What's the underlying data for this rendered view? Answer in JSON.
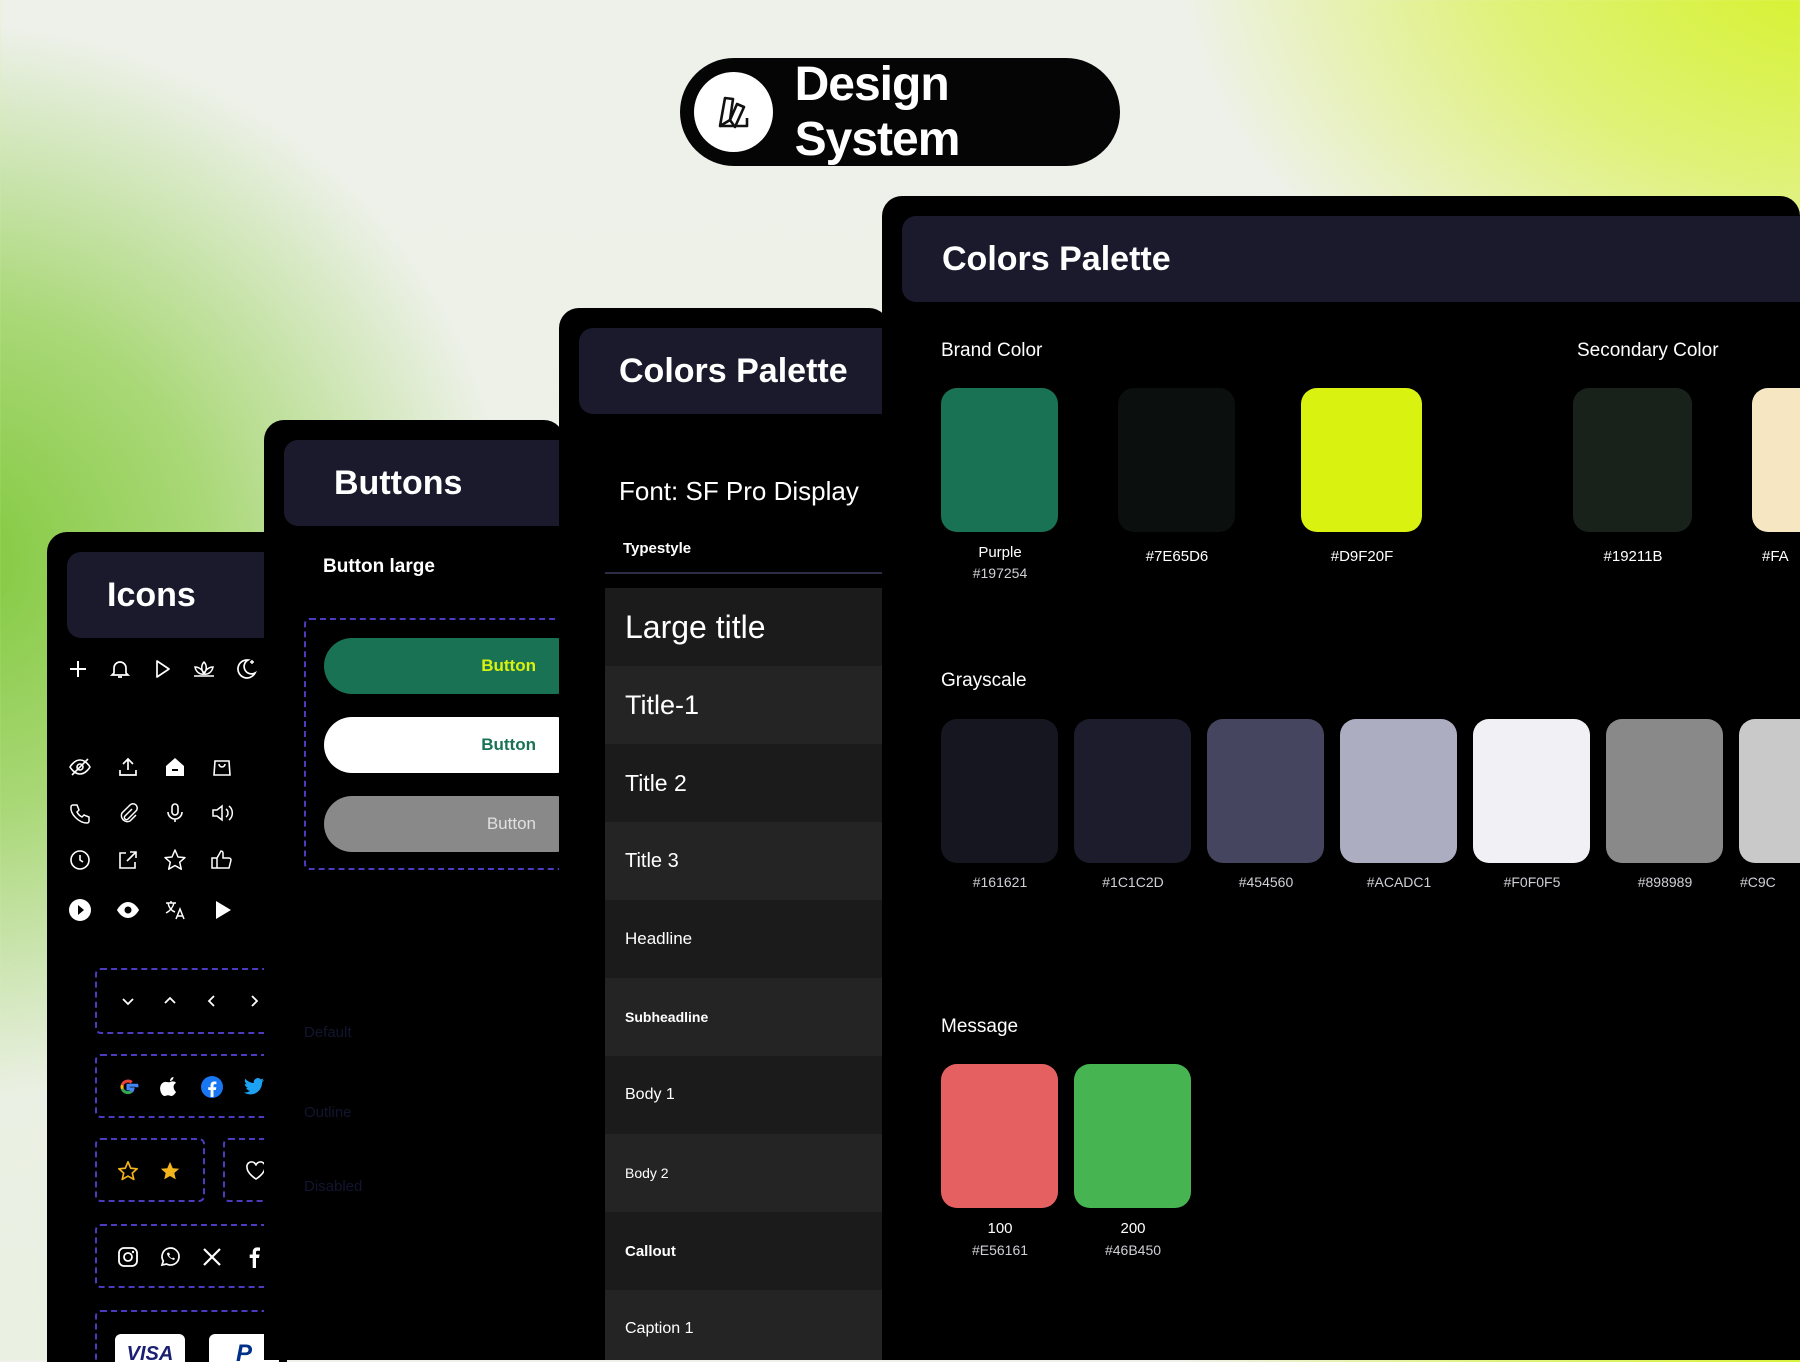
{
  "header": {
    "title": "Design System",
    "logo_icon": "color-swatch-icon"
  },
  "icons_card": {
    "title": "Icons",
    "icons_row1": [
      "plus-icon",
      "bell-icon",
      "play-outline-icon",
      "lotus-icon",
      "moon-star-icon"
    ],
    "icons_row2": [
      "eye-off-icon",
      "upload-icon",
      "home-filled-icon",
      "bag-icon"
    ],
    "icons_row3": [
      "phone-icon",
      "paperclip-icon",
      "microphone-icon",
      "speaker-icon"
    ],
    "icons_row4": [
      "clock-icon",
      "external-link-icon",
      "star-outline-icon",
      "thumbs-up-icon"
    ],
    "icons_row5": [
      "play-circle-icon",
      "eye-icon",
      "translate-icon",
      "play-filled-icon"
    ],
    "chevrons": [
      "chevron-down-icon",
      "chevron-up-icon",
      "chevron-left-icon",
      "chevron-right-icon"
    ],
    "brand_icons": [
      "google-icon",
      "apple-icon",
      "facebook-icon",
      "twitter-icon"
    ],
    "rating_icons": [
      "star-outline-icon",
      "star-filled-icon",
      "heart-icon"
    ],
    "social_icons": [
      "instagram-icon",
      "whatsapp-icon",
      "x-icon",
      "facebook-f-icon"
    ],
    "payment": {
      "visa": "VISA",
      "paypal": "P"
    }
  },
  "buttons_card": {
    "title": "Buttons",
    "subtitle": "Button large",
    "buttons": [
      {
        "label": "Button",
        "bg": "#197254",
        "color": "#D9F20F"
      },
      {
        "label": "Button",
        "bg": "#FFFFFF",
        "color": "#197254"
      },
      {
        "label": "Button",
        "bg": "#898989",
        "color": "#E0E0E0"
      }
    ],
    "faint_labels": [
      "Default",
      "Outline",
      "Disabled"
    ]
  },
  "type_card": {
    "title": "Colors Palette",
    "font_label": "Font: SF Pro Display",
    "typestyle_header": "Typestyle",
    "styles": [
      "Large title",
      "Title-1",
      "Title 2",
      "Title 3",
      "Headline",
      "Subheadline",
      "Body 1",
      "Body 2",
      "Callout",
      "Caption 1"
    ]
  },
  "colors_card": {
    "title": "Colors Palette",
    "brand_label": "Brand Color",
    "secondary_label": "Secondary Color",
    "grayscale_label": "Grayscale",
    "message_label": "Message",
    "brand": [
      {
        "name": "Purple",
        "hex": "#197254",
        "fill": "#197254"
      },
      {
        "name": "",
        "hex": "#7E65D6",
        "fill": "#0b0f0d"
      },
      {
        "name": "",
        "hex": "#D9F20F",
        "fill": "#D9F20F"
      }
    ],
    "secondary": [
      {
        "hex": "#19211B",
        "fill": "#19211B"
      },
      {
        "hex": "#FA",
        "fill": "#F6E6C2"
      }
    ],
    "grayscale": [
      {
        "hex": "#161621",
        "fill": "#161621"
      },
      {
        "hex": "#1C1C2D",
        "fill": "#1C1C2D"
      },
      {
        "hex": "#454560",
        "fill": "#454560"
      },
      {
        "hex": "#ACADC1",
        "fill": "#ACADC1"
      },
      {
        "hex": "#F0F0F5",
        "fill": "#F0F0F5"
      },
      {
        "hex": "#898989",
        "fill": "#898989"
      },
      {
        "hex": "#C9C",
        "fill": "#C9C9C9"
      }
    ],
    "message": [
      {
        "name": "100",
        "hex": "#E56161",
        "fill": "#E56161"
      },
      {
        "name": "200",
        "hex": "#46B450",
        "fill": "#46B450"
      }
    ]
  }
}
